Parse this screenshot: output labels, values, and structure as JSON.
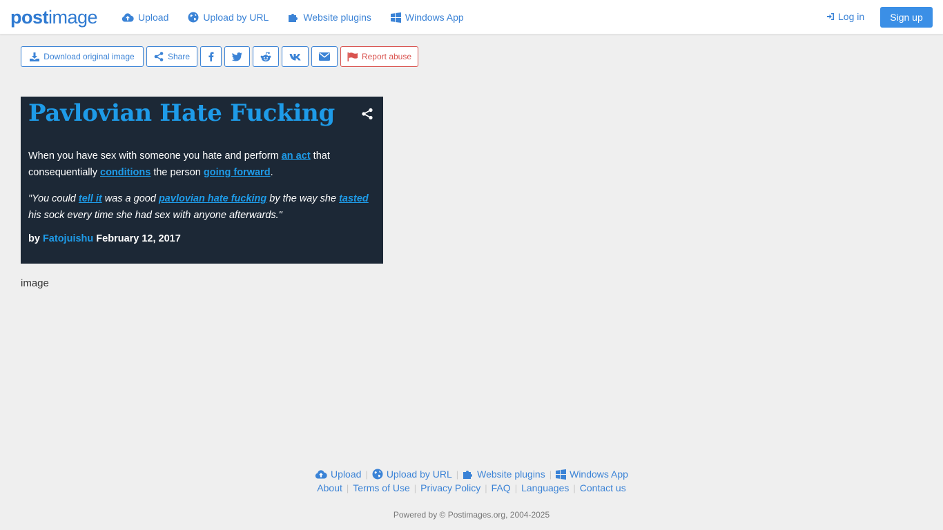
{
  "brand": {
    "logo_bold": "post",
    "logo_light": "image",
    "accent": "#3b83d6"
  },
  "nav": {
    "items": [
      {
        "label": "Upload",
        "icon": "cloud-upload-icon"
      },
      {
        "label": "Upload by URL",
        "icon": "globe-icon"
      },
      {
        "label": "Website plugins",
        "icon": "puzzle-icon"
      },
      {
        "label": "Windows App",
        "icon": "windows-icon"
      }
    ],
    "login": "Log in",
    "signup": "Sign up"
  },
  "toolbar": {
    "download": "Download original image",
    "share": "Share",
    "report": "Report abuse"
  },
  "image": {
    "title": "Pavlovian Hate Fucking",
    "definition": {
      "t1": "When you have sex with someone you hate and perform ",
      "l1": "an act",
      "t2": " that consequentially ",
      "l2": "conditions",
      "t3": " the person ",
      "l3": "going forward",
      "t4": "."
    },
    "example": {
      "t1": "\"You could ",
      "l1": "tell it",
      "t2": " was a good ",
      "l2": "pavlovian hate fucking",
      "t3": " by the way she ",
      "l3": "tasted",
      "t4": " his sock every time she had sex with anyone afterwards.\""
    },
    "byline": {
      "by": "by ",
      "author": "Fatojuishu",
      "date": " February 12, 2017"
    },
    "caption": "image"
  },
  "footer": {
    "row1": [
      "Upload",
      "Upload by URL",
      "Website plugins",
      "Windows App"
    ],
    "row2": [
      "About",
      "Terms of Use",
      "Privacy Policy",
      "FAQ",
      "Languages",
      "Contact us"
    ],
    "powered": "Powered by © Postimages.org, 2004-2025"
  }
}
